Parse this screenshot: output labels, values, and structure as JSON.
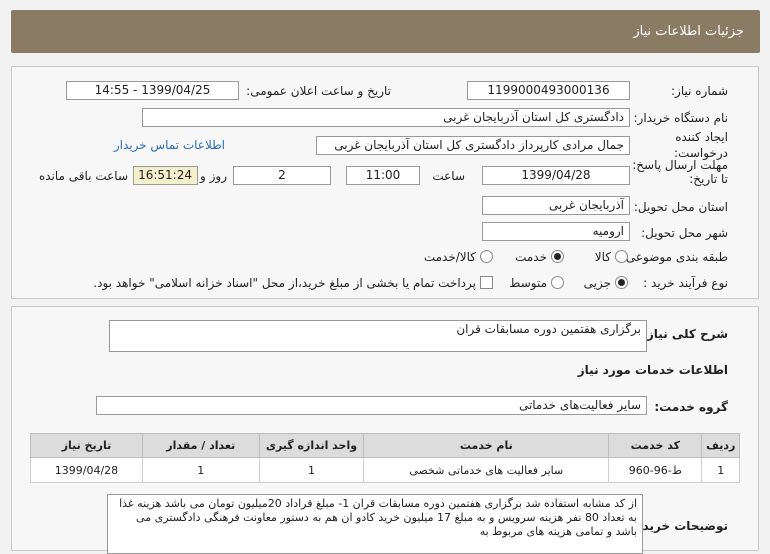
{
  "header": {
    "title": "جزئیات اطلاعات نیاز"
  },
  "form": {
    "need_number_label": "شماره نیاز:",
    "need_number": "1199000493000136",
    "announce_label": "تاریخ و ساعت اعلان عمومی:",
    "announce_value": "1399/04/25 - 14:55",
    "buyer_label": "نام دستگاه خریدار:",
    "buyer_value": "دادگستری کل استان آذربایجان غربی",
    "creator_label_1": "ایجاد کننده",
    "creator_label_2": "درخواست:",
    "creator_value": "جمال مرادی کارپرداز دادگستری کل استان آذربایجان غربی",
    "contact_link": "اطلاعات تماس خریدار",
    "deadline_label_1": "مهلت ارسال پاسخ:",
    "deadline_label_2": "تا تاریخ:",
    "deadline_date": "1399/04/28",
    "time_label": "ساعت",
    "deadline_time": "11:00",
    "days_value": "2",
    "days_label": "روز و",
    "remaining_time": "16:51:24",
    "remaining_label": "ساعت باقی مانده",
    "province_label": "استان محل تحویل:",
    "province_value": "آذربایجان غربی",
    "city_label": "شهر محل تحویل:",
    "city_value": "ارومیه",
    "category_label": "طبقه بندی موضوعی:",
    "category_options": [
      "کالا",
      "خدمت",
      "کالا/خدمت"
    ],
    "category_selected": "خدمت",
    "process_label": "نوع فرآیند خرید :",
    "process_options": [
      "جزیی",
      "متوسط"
    ],
    "process_selected": "جزیی",
    "payment_note": "پرداخت تمام یا بخشی از مبلغ خرید،از محل \"اسناد خزانه اسلامی\" خواهد بود."
  },
  "summary": {
    "label": "شرح کلی نیاز:",
    "value": "برگزاری هفتمین دوره مسابقات قران"
  },
  "services": {
    "section_title": "اطلاعات خدمات مورد نیاز",
    "group_label": "گروه خدمت:",
    "group_value": "سایر فعالیت‌های خدماتی",
    "columns": [
      "ردیف",
      "کد خدمت",
      "نام خدمت",
      "واحد اندازه گیری",
      "تعداد / مقدار",
      "تاریخ نیاز"
    ],
    "rows": [
      [
        "1",
        "ط-96-960",
        "سایر فعالیت های خدماتی شخصی",
        "1",
        "1",
        "1399/04/28"
      ]
    ]
  },
  "buyer_notes": {
    "label": "توضیحات خریدار:",
    "text": "از کد مشابه استفاده شد  برگزاری هفتمین دوره مسابقات قران 1- مبلغ قراداد 20میلیون تومان می باشد  هزینه غذا به تعداد 80 نفر  هزینه سرویس و به مبلغ 17 میلیون خرید کادو ان هم به دستور معاونت فرهنگی دادگستری  می باشد  و تمامی هزینه های مربوط به"
  }
}
